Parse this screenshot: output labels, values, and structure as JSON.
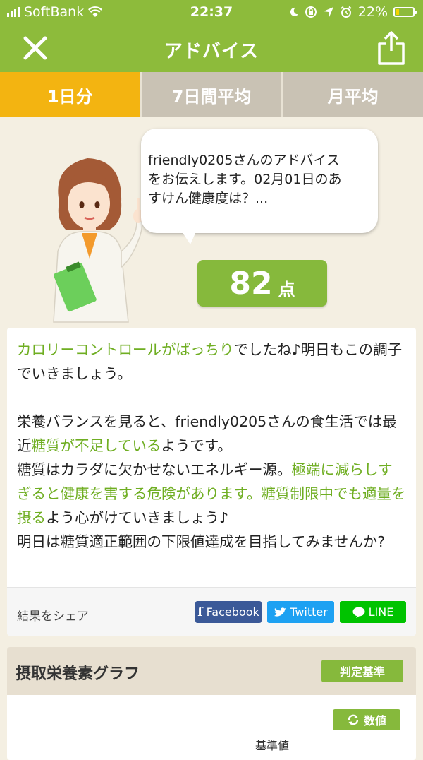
{
  "status_bar": {
    "carrier": "SoftBank",
    "time": "22:37",
    "battery": "22%",
    "battery_level": 0.22,
    "icons": [
      "signal-icon",
      "wifi-icon",
      "moon-icon",
      "rotation-lock-icon",
      "location-icon",
      "alarm-icon",
      "battery-icon"
    ]
  },
  "nav": {
    "title": "アドバイス",
    "close_icon": "close-icon",
    "share_icon": "share-icon"
  },
  "tabs": [
    {
      "label": "1日分",
      "active": true
    },
    {
      "label": "7日間平均",
      "active": false
    },
    {
      "label": "月平均",
      "active": false
    }
  ],
  "bubble": {
    "line1": "friendly0205さんのアドバイス",
    "line2": "をお伝えします。02月01日のあ",
    "line3": "すけん健康度は？..."
  },
  "score": {
    "value": "82",
    "unit": "点"
  },
  "advice": {
    "p1": {
      "hl": "カロリーコントロールがばっちり",
      "rest": "でしたね♪明日もこの調子でいきましょう。"
    },
    "p2": {
      "s1": "栄養バランスを見ると、friendly0205さんの食生活では最近",
      "s1_hl": "糖質が不足している",
      "s1_end": "ようです。",
      "s2": "糖質はカラダに欠かせないエネルギー源。",
      "s2_hl": "極端に減らしすぎると健康を害する危険があります。糖質制限中でも適量を摂る",
      "s2_end": "よう心がけていきましょう♪",
      "s3": "明日は糖質適正範囲の下限値達成を目指してみませんか?"
    },
    "colors": {
      "highlight": "#6fae22",
      "accent": "#8dbb3b",
      "tab_active": "#f3b411"
    }
  },
  "share": {
    "label": "結果をシェア",
    "facebook": "Facebook",
    "twitter": "Twitter",
    "line": "LINE"
  },
  "graph": {
    "title": "摂取栄養素グラフ",
    "criteria_button": "判定基準",
    "values_button": "数値",
    "baseline_label": "基準値"
  }
}
